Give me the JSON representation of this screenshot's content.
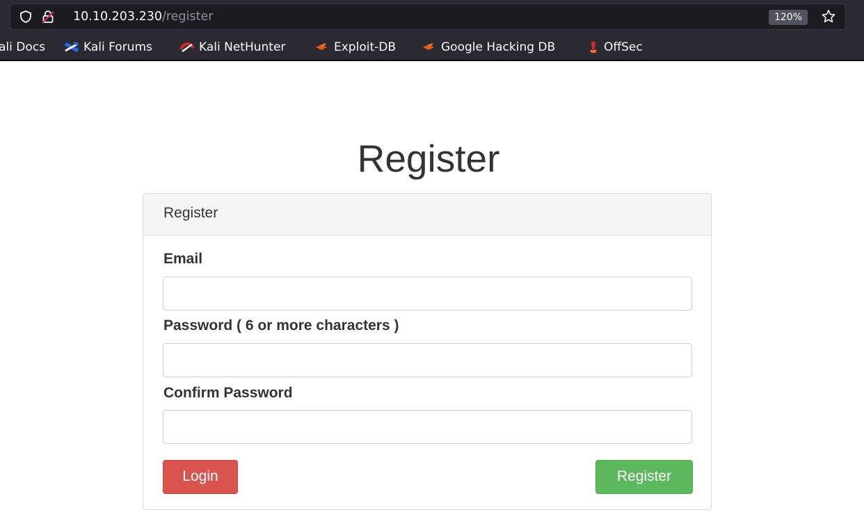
{
  "browser": {
    "url_host": "10.10.203.230",
    "url_path": "/register",
    "zoom": "120%",
    "bookmarks": [
      {
        "label": "ali Docs",
        "icon": "kali-docs-icon"
      },
      {
        "label": "Kali Forums",
        "icon": "kali-forums-icon"
      },
      {
        "label": "Kali NetHunter",
        "icon": "kali-nethunter-icon"
      },
      {
        "label": "Exploit-DB",
        "icon": "exploit-db-icon"
      },
      {
        "label": "Google Hacking DB",
        "icon": "ghdb-icon"
      },
      {
        "label": "OffSec",
        "icon": "offsec-icon"
      }
    ]
  },
  "page": {
    "title": "Register"
  },
  "panel": {
    "heading": "Register",
    "fields": {
      "email_label": "Email",
      "email_value": "",
      "password_label": "Password ( 6 or more characters )",
      "password_value": "",
      "confirm_label": "Confirm Password",
      "confirm_value": ""
    },
    "login_button": "Login",
    "register_button": "Register"
  },
  "colors": {
    "login_button": "#d9534f",
    "register_button": "#5cb85c",
    "chrome_background": "#2b2a33"
  }
}
